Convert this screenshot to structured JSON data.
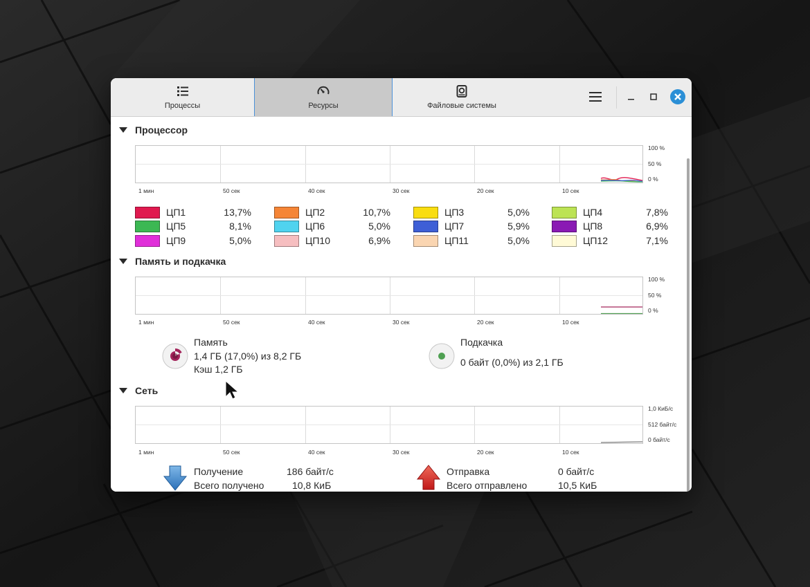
{
  "tabs": [
    {
      "label": "Процессы",
      "icon": "list-icon"
    },
    {
      "label": "Ресурсы",
      "icon": "gauge-icon"
    },
    {
      "label": "Файловые системы",
      "icon": "disk-icon"
    }
  ],
  "header": {
    "active_tab": "Ресурсы"
  },
  "time_axis": [
    "1 мин",
    "50 сек",
    "40 сек",
    "30 сек",
    "20 сек",
    "10 сек"
  ],
  "cpu": {
    "title": "Процессор",
    "y_labels": [
      "100 %",
      "50 %",
      "0 %"
    ],
    "cores": [
      {
        "name": "ЦП1",
        "value": "13,7%",
        "color": "#e0194f"
      },
      {
        "name": "ЦП2",
        "value": "10,7%",
        "color": "#f58536"
      },
      {
        "name": "ЦП3",
        "value": "5,0%",
        "color": "#f9dd10"
      },
      {
        "name": "ЦП4",
        "value": "7,8%",
        "color": "#bce354"
      },
      {
        "name": "ЦП5",
        "value": "8,1%",
        "color": "#3cb853"
      },
      {
        "name": "ЦП6",
        "value": "5,0%",
        "color": "#50d3ef"
      },
      {
        "name": "ЦП7",
        "value": "5,9%",
        "color": "#3e5fd6"
      },
      {
        "name": "ЦП8",
        "value": "6,9%",
        "color": "#8a1ab4"
      },
      {
        "name": "ЦП9",
        "value": "5,0%",
        "color": "#e02fd9"
      },
      {
        "name": "ЦП10",
        "value": "6,9%",
        "color": "#f6bec0"
      },
      {
        "name": "ЦП11",
        "value": "5,0%",
        "color": "#fad5b1"
      },
      {
        "name": "ЦП12",
        "value": "7,1%",
        "color": "#fffad6"
      }
    ]
  },
  "memory": {
    "title": "Память и подкачка",
    "y_labels": [
      "100 %",
      "50 %",
      "0 %"
    ],
    "mem_label": "Память",
    "mem_value": "1,4 ГБ (17,0%) из 8,2 ГБ",
    "mem_cache": "Кэш 1,2 ГБ",
    "mem_fraction": 0.17,
    "mem_color": "#a3245b",
    "swap_label": "Подкачка",
    "swap_value": "0 байт (0,0%) из 2,1 ГБ",
    "swap_fraction": 0.0,
    "swap_color": "#4fa052"
  },
  "network": {
    "title": "Сеть",
    "y_labels": [
      "1,0 КиБ/с",
      "512 байт/с",
      "0 байт/с"
    ],
    "recv_label": "Получение",
    "recv_value": "186 байт/с",
    "recv_total_label": "Всего получено",
    "recv_total_value": "10,8 КиБ",
    "send_label": "Отправка",
    "send_value": "0 байт/с",
    "send_total_label": "Всего отправлено",
    "send_total_value": "10,5 КиБ"
  }
}
